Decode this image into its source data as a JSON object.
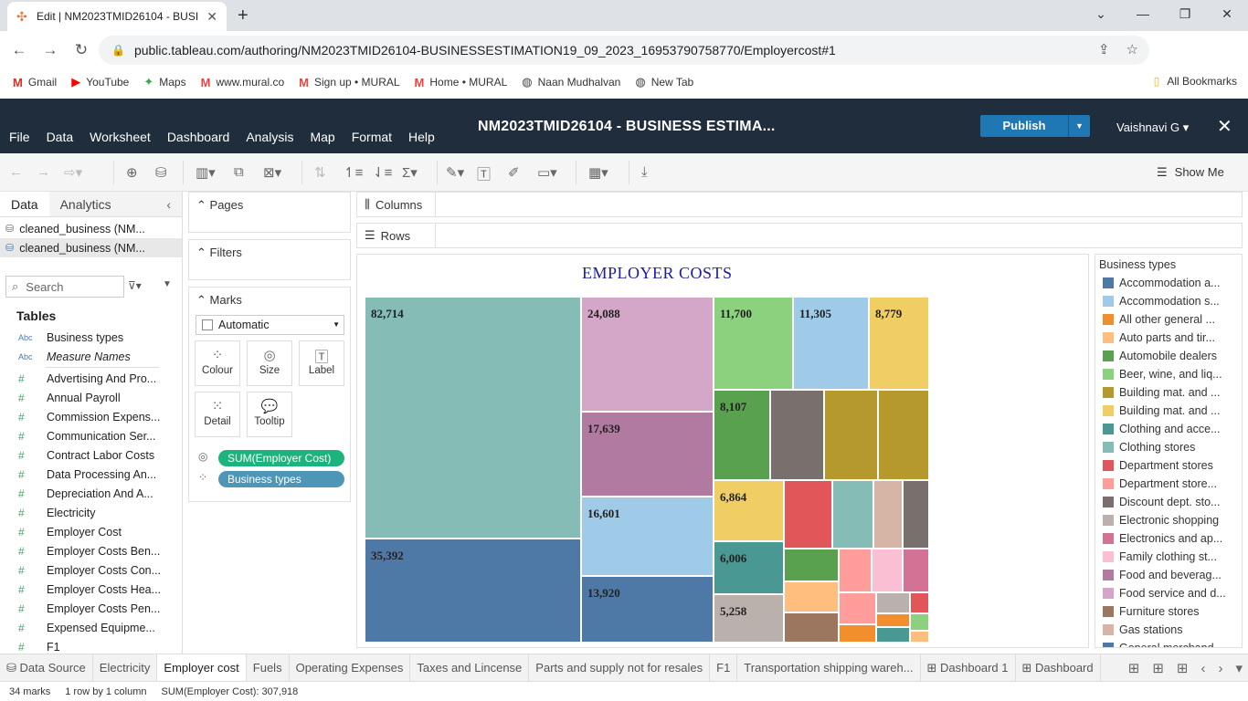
{
  "browser": {
    "tab_title": "Edit | NM2023TMID26104 - BUSI",
    "url": "public.tableau.com/authoring/NM2023TMID26104-BUSINESSESTIMATION19_09_2023_16953790758770/Employercost#1",
    "bookmarks": [
      {
        "label": "Gmail",
        "icon": "gmail-icon",
        "color": "#d93025"
      },
      {
        "label": "YouTube",
        "icon": "youtube-icon",
        "color": "#ff0000"
      },
      {
        "label": "Maps",
        "icon": "maps-icon",
        "color": "#34a853"
      },
      {
        "label": "www.mural.co",
        "icon": "mural-icon",
        "color": "#e8453c"
      },
      {
        "label": "Sign up • MURAL",
        "icon": "mural-icon",
        "color": "#e8453c"
      },
      {
        "label": "Home • MURAL",
        "icon": "mural-icon",
        "color": "#e8453c"
      },
      {
        "label": "Naan Mudhalvan",
        "icon": "globe-icon",
        "color": "#444444"
      },
      {
        "label": "New Tab",
        "icon": "globe-icon",
        "color": "#444444"
      }
    ],
    "all_bookmarks": "All Bookmarks"
  },
  "tableau": {
    "menu": [
      "File",
      "Data",
      "Worksheet",
      "Dashboard",
      "Analysis",
      "Map",
      "Format",
      "Help"
    ],
    "workbook_title": "NM2023TMID26104 - BUSINESS ESTIMA...",
    "publish_label": "Publish",
    "user_name": "Vaishnavi G",
    "show_me": "Show Me",
    "header_color": "#1f2d3d",
    "publish_color": "#1f77b4"
  },
  "data_pane": {
    "tab_data": "Data",
    "tab_analytics": "Analytics",
    "sources": [
      "cleaned_business (NM...",
      "cleaned_business (NM..."
    ],
    "search_placeholder": "Search",
    "tables_heading": "Tables",
    "dimensions": [
      {
        "type": "Abc",
        "name": "Business types"
      },
      {
        "type": "Abc",
        "name": "Measure Names"
      }
    ],
    "measures": [
      "Advertising And Pro...",
      "Annual Payroll",
      "Commission Expens...",
      "Communication Ser...",
      "Contract Labor Costs",
      "Data Processing An...",
      "Depreciation And A...",
      "Electricity",
      "Employer Cost",
      "Employer Costs Ben...",
      "Employer Costs Con...",
      "Employer Costs Hea...",
      "Employer Costs Pen...",
      "Expensed Equipme...",
      "F1"
    ]
  },
  "cards": {
    "pages": "Pages",
    "filters": "Filters",
    "marks": "Marks",
    "mark_type": "Automatic",
    "buttons": [
      "Colour",
      "Size",
      "Label",
      "Detail",
      "Tooltip"
    ],
    "pill_measure": "SUM(Employer Cost)",
    "pill_dimension": "Business types",
    "pill_measure_color": "#1db37c",
    "pill_dimension_color": "#4e96b8"
  },
  "shelves": {
    "columns": "Columns",
    "rows": "Rows"
  },
  "chart_data": {
    "type": "treemap",
    "title": "EMPLOYER COSTS",
    "measure": "SUM(Employer Cost)",
    "labeled_values": [
      82714,
      35392,
      24088,
      17639,
      16601,
      13920,
      11700,
      11305,
      8779,
      8107,
      6864,
      6006,
      5258
    ]
  },
  "legend": {
    "title": "Business types",
    "items": [
      {
        "name": "Accommodation a...",
        "color": "#4e79a7"
      },
      {
        "name": "Accommodation s...",
        "color": "#a0cbe8"
      },
      {
        "name": "All other general ...",
        "color": "#f28e2b"
      },
      {
        "name": "Auto parts and tir...",
        "color": "#ffbe7d"
      },
      {
        "name": "Automobile dealers",
        "color": "#59a14f"
      },
      {
        "name": "Beer, wine, and liq...",
        "color": "#8cd17d"
      },
      {
        "name": "Building mat. and ...",
        "color": "#b6992d"
      },
      {
        "name": "Building mat. and ...",
        "color": "#f1ce63"
      },
      {
        "name": "Clothing and acce...",
        "color": "#499894"
      },
      {
        "name": "Clothing stores",
        "color": "#86bcb6"
      },
      {
        "name": "Department stores",
        "color": "#e15759"
      },
      {
        "name": "Department store...",
        "color": "#ff9d9a"
      },
      {
        "name": "Discount dept. sto...",
        "color": "#79706e"
      },
      {
        "name": "Electronic shopping",
        "color": "#bab0ac"
      },
      {
        "name": "Electronics and ap...",
        "color": "#d37295"
      },
      {
        "name": "Family clothing st...",
        "color": "#fabfd2"
      },
      {
        "name": "Food and beverag...",
        "color": "#b07aa1"
      },
      {
        "name": "Food service and d...",
        "color": "#d4a6c8"
      },
      {
        "name": "Furniture stores",
        "color": "#9d7660"
      },
      {
        "name": "Gas stations",
        "color": "#d7b5a6"
      },
      {
        "name": "General merchand...",
        "color": "#4e79a7"
      }
    ]
  },
  "sheet_tabs": [
    "Data Source",
    "Electricity",
    "Employer cost",
    "Fuels",
    "Operating Expenses",
    "Taxes and Lincense",
    "Parts and supply not for resales",
    "F1",
    "Transportation shipping wareh...",
    "Dashboard 1",
    "Dashboard"
  ],
  "active_sheet": "Employer cost",
  "status": {
    "marks": "34 marks",
    "rows_cols": "1 row by 1 column",
    "sum": "SUM(Employer Cost): 307,918"
  }
}
